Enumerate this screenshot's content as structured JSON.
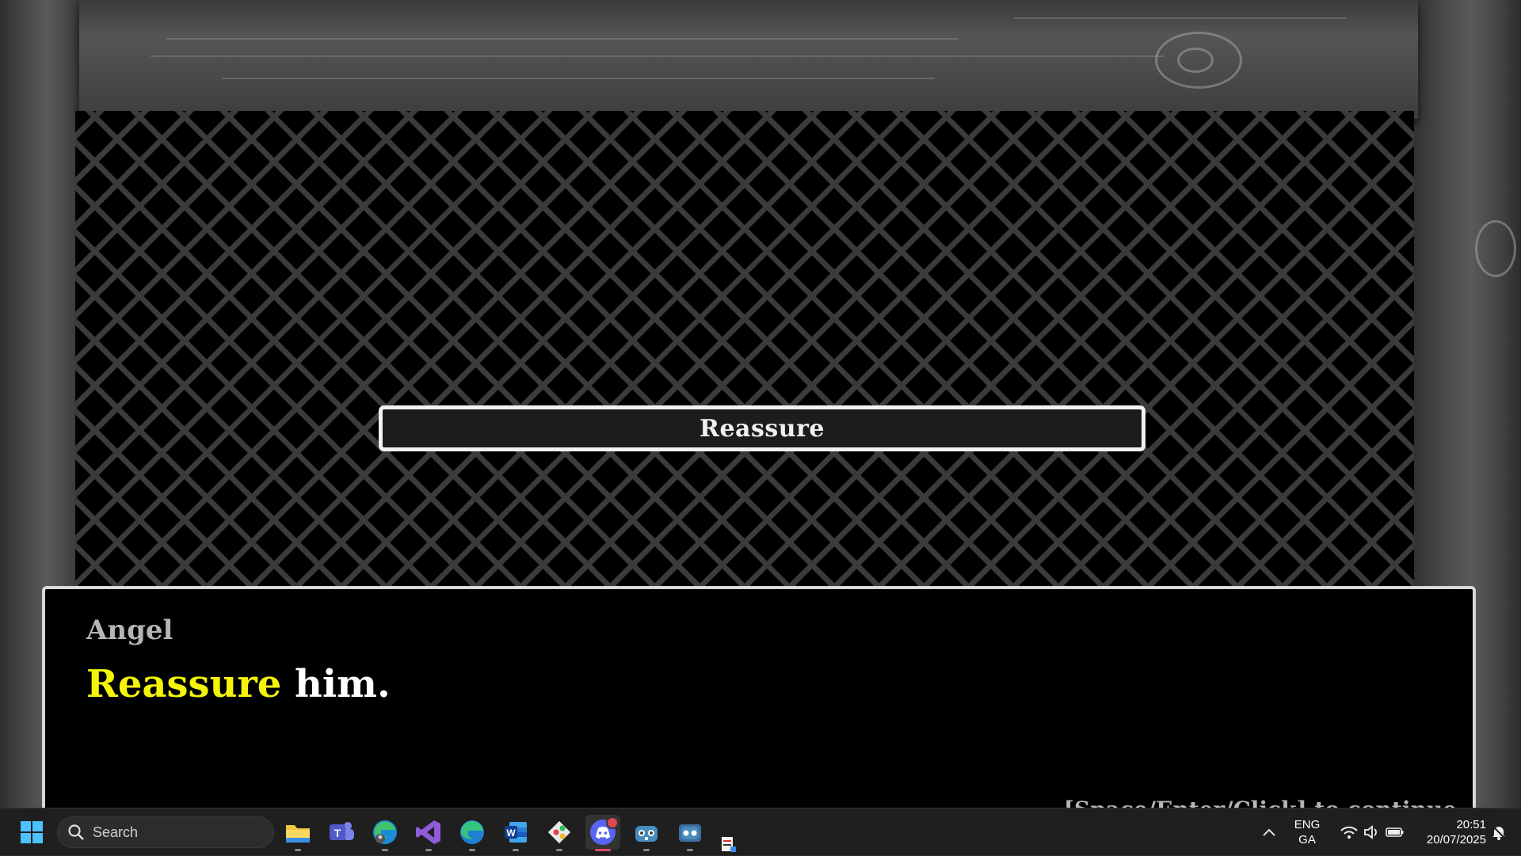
{
  "game": {
    "choice_label": "Reassure",
    "speaker": "Angel",
    "line_highlight": "Reassure",
    "line_rest": " him.",
    "continue_hint": "[Space/Enter/Click] to continue",
    "colors": {
      "highlight": "#f4f40a",
      "text": "#ffffff",
      "speaker": "#b5b5b5"
    }
  },
  "taskbar": {
    "search_label": "Search",
    "apps": [
      {
        "name": "file-explorer-icon"
      },
      {
        "name": "teams-icon"
      },
      {
        "name": "edge-profile-icon"
      },
      {
        "name": "visual-studio-icon"
      },
      {
        "name": "edge-icon"
      },
      {
        "name": "word-icon"
      },
      {
        "name": "git-icon"
      },
      {
        "name": "discord-icon"
      },
      {
        "name": "godot-icon"
      },
      {
        "name": "godot-icon-2"
      }
    ],
    "tray": {
      "lang_1": "ENG",
      "lang_2": "GA",
      "time": "20:51",
      "date": "20/07/2025"
    }
  }
}
